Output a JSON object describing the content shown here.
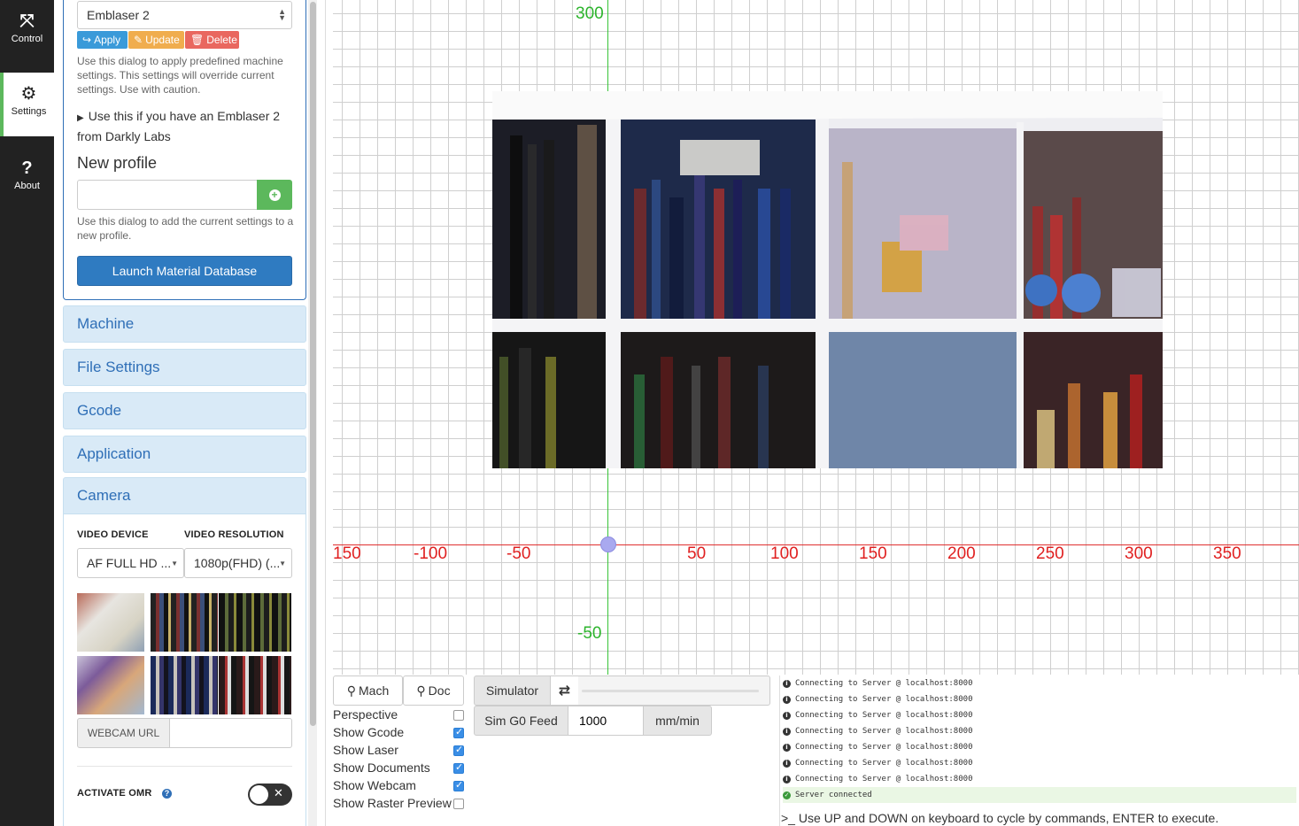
{
  "nav": {
    "items": [
      {
        "label": "Control",
        "icon": "expand-arrows-icon"
      },
      {
        "label": "Settings",
        "icon": "gears-icon"
      },
      {
        "label": "About",
        "icon": "question-icon"
      }
    ]
  },
  "profile": {
    "selected": "Emblaser 2",
    "apply_label": "Apply",
    "update_label": "Update",
    "delete_label": "Delete",
    "help_text": "Use this dialog to apply predefined machine settings. This settings will override current settings. Use with caution.",
    "note_line1": "Use this if you have an Emblaser 2",
    "note_line2": "from Darkly Labs",
    "new_profile_heading": "New profile",
    "new_profile_value": "",
    "new_profile_help": "Use this dialog to add the current settings to a new profile.",
    "launch_label": "Launch Material Database"
  },
  "accordion": {
    "items": [
      "Machine",
      "File Settings",
      "Gcode",
      "Application",
      "Camera"
    ]
  },
  "camera": {
    "video_device_label": "VIDEO DEVICE",
    "video_resolution_label": "VIDEO RESOLUTION",
    "video_device_value": "AF FULL HD ...",
    "video_resolution_value": "1080p(FHD) (...",
    "webcam_url_label": "WEBCAM URL",
    "webcam_url_value": "",
    "activate_omr_label": "ACTIVATE OMR"
  },
  "canvas": {
    "x_ticks": [
      "150",
      "-100",
      "-50",
      "50",
      "100",
      "150",
      "200",
      "250",
      "300",
      "350"
    ],
    "y_ticks": [
      "300",
      "-50"
    ]
  },
  "controls": {
    "mach_label": "Mach",
    "doc_label": "Doc",
    "simulator_label": "Simulator",
    "sim_feed_label": "Sim G0 Feed",
    "sim_feed_value": "1000",
    "sim_feed_unit": "mm/min",
    "options": [
      {
        "label": "Perspective",
        "checked": false
      },
      {
        "label": "Show Gcode",
        "checked": true
      },
      {
        "label": "Show Laser",
        "checked": true
      },
      {
        "label": "Show Documents",
        "checked": true
      },
      {
        "label": "Show Webcam",
        "checked": true
      },
      {
        "label": "Show Raster Preview",
        "checked": false
      }
    ]
  },
  "console": {
    "lines": [
      "Connecting to Server @ localhost:8000",
      "Connecting to Server @ localhost:8000",
      "Connecting to Server @ localhost:8000",
      "Connecting to Server @ localhost:8000",
      "Connecting to Server @ localhost:8000",
      "Connecting to Server @ localhost:8000",
      "Connecting to Server @ localhost:8000"
    ],
    "success_line": "Server connected",
    "prompt": ">_ Use UP and DOWN on keyboard to cycle by commands, ENTER to execute."
  }
}
